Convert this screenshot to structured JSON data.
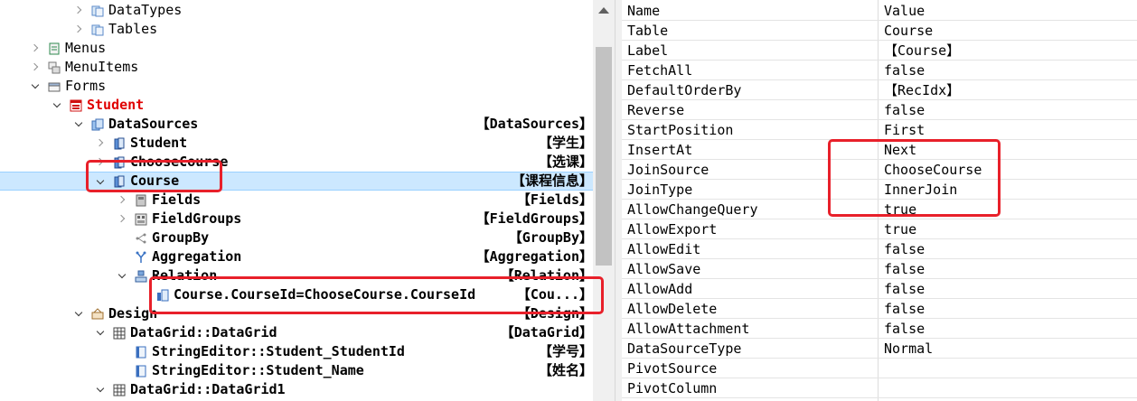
{
  "tree": [
    {
      "level": 3,
      "arrow": "closed",
      "icon": "table-group-icon",
      "label": "DataTypes"
    },
    {
      "level": 3,
      "arrow": "closed",
      "icon": "table-group-icon",
      "label": "Tables"
    },
    {
      "level": 1,
      "arrow": "closed",
      "icon": "menu-icon",
      "label": "Menus"
    },
    {
      "level": 1,
      "arrow": "closed",
      "icon": "menu-items-icon",
      "label": "MenuItems"
    },
    {
      "level": 1,
      "arrow": "open",
      "icon": "forms-folder-icon",
      "label": "Forms"
    },
    {
      "level": 2,
      "arrow": "open",
      "icon": "form-icon",
      "label": "Student",
      "bold": true,
      "red": true
    },
    {
      "level": 3,
      "arrow": "open",
      "icon": "datasources-icon",
      "label": "DataSources",
      "bold": true,
      "right": "【DataSources】"
    },
    {
      "level": 4,
      "arrow": "closed",
      "icon": "datasource-icon",
      "label": "Student",
      "bold": true,
      "right": "【学生】"
    },
    {
      "level": 4,
      "arrow": "closed",
      "icon": "datasource-icon",
      "label": "ChooseCourse",
      "bold": true,
      "right": "【选课】"
    },
    {
      "level": 4,
      "arrow": "open",
      "icon": "datasource-icon",
      "label": "Course",
      "bold": true,
      "right": "【课程信息】",
      "selected": true
    },
    {
      "level": 5,
      "arrow": "closed",
      "icon": "fields-icon",
      "label": "Fields",
      "bold": true,
      "right": "【Fields】"
    },
    {
      "level": 5,
      "arrow": "closed",
      "icon": "fieldgroups-icon",
      "label": "FieldGroups",
      "bold": true,
      "right": "【FieldGroups】"
    },
    {
      "level": 5,
      "arrow": "",
      "icon": "groupby-icon",
      "label": "GroupBy",
      "bold": true,
      "right": "【GroupBy】"
    },
    {
      "level": 5,
      "arrow": "",
      "icon": "aggregation-icon",
      "label": "Aggregation",
      "bold": true,
      "right": "【Aggregation】"
    },
    {
      "level": 5,
      "arrow": "open",
      "icon": "relation-icon",
      "label": "Relation",
      "bold": true,
      "right": "【Relation】"
    },
    {
      "level": 6,
      "arrow": "",
      "icon": "relation-item-icon",
      "label": "Course.CourseId=ChooseCourse.CourseId",
      "bold": true,
      "right": "【Cou...】"
    },
    {
      "level": 3,
      "arrow": "open",
      "icon": "design-icon",
      "label": "Design",
      "bold": true,
      "right": "【Design】"
    },
    {
      "level": 4,
      "arrow": "open",
      "icon": "datagrid-icon",
      "label": "DataGrid::DataGrid",
      "bold": true,
      "right": "【DataGrid】"
    },
    {
      "level": 5,
      "arrow": "",
      "icon": "string-editor-icon",
      "label": "StringEditor::Student_StudentId",
      "bold": true,
      "right": "【学号】"
    },
    {
      "level": 5,
      "arrow": "",
      "icon": "string-editor-icon",
      "label": "StringEditor::Student_Name",
      "bold": true,
      "right": "【姓名】"
    },
    {
      "level": 4,
      "arrow": "open",
      "icon": "datagrid-icon",
      "label": "DataGrid::DataGrid1",
      "bold": true,
      "right": ""
    }
  ],
  "properties": {
    "header": {
      "name": "Name",
      "value": "Value"
    },
    "rows": [
      {
        "name": "Table",
        "value": "Course"
      },
      {
        "name": "Label",
        "value": "【Course】"
      },
      {
        "name": "FetchAll",
        "value": "false"
      },
      {
        "name": "DefaultOrderBy",
        "value": "【RecIdx】"
      },
      {
        "name": "Reverse",
        "value": "false"
      },
      {
        "name": "StartPosition",
        "value": "First"
      },
      {
        "name": "InsertAt",
        "value": "Next"
      },
      {
        "name": "JoinSource",
        "value": "ChooseCourse"
      },
      {
        "name": "JoinType",
        "value": "InnerJoin"
      },
      {
        "name": "AllowChangeQuery",
        "value": "true"
      },
      {
        "name": "AllowExport",
        "value": "true"
      },
      {
        "name": "AllowEdit",
        "value": "false"
      },
      {
        "name": "AllowSave",
        "value": "false"
      },
      {
        "name": "AllowAdd",
        "value": "false"
      },
      {
        "name": "AllowDelete",
        "value": "false"
      },
      {
        "name": "AllowAttachment",
        "value": "false"
      },
      {
        "name": "DataSourceType",
        "value": "Normal"
      },
      {
        "name": "PivotSource",
        "value": ""
      },
      {
        "name": "PivotColumn",
        "value": ""
      }
    ]
  },
  "colors": {
    "selection": "#cce8ff",
    "highlight": "#e8202a",
    "form_label": "#e00000"
  }
}
